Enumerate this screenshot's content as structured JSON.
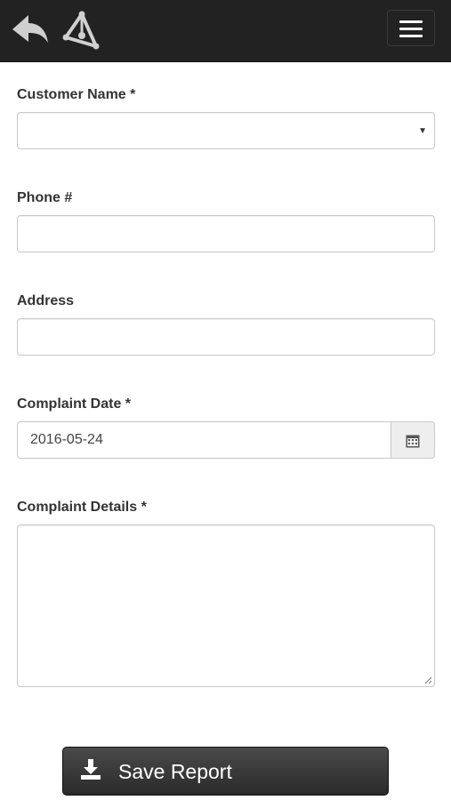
{
  "navbar": {
    "back_icon": "back-arrow-icon",
    "logo_icon": "triangle-logo-icon",
    "menu_icon": "hamburger-menu-icon",
    "background": "#222222"
  },
  "form": {
    "customer_name": {
      "label": "Customer Name *",
      "value": ""
    },
    "phone": {
      "label": "Phone #",
      "value": ""
    },
    "address": {
      "label": "Address",
      "value": ""
    },
    "complaint_date": {
      "label": "Complaint Date *",
      "value": "2016-05-24",
      "icon": "calendar-icon"
    },
    "complaint_details": {
      "label": "Complaint Details *",
      "value": ""
    }
  },
  "save_button": {
    "label": "Save Report",
    "icon": "download-icon"
  }
}
